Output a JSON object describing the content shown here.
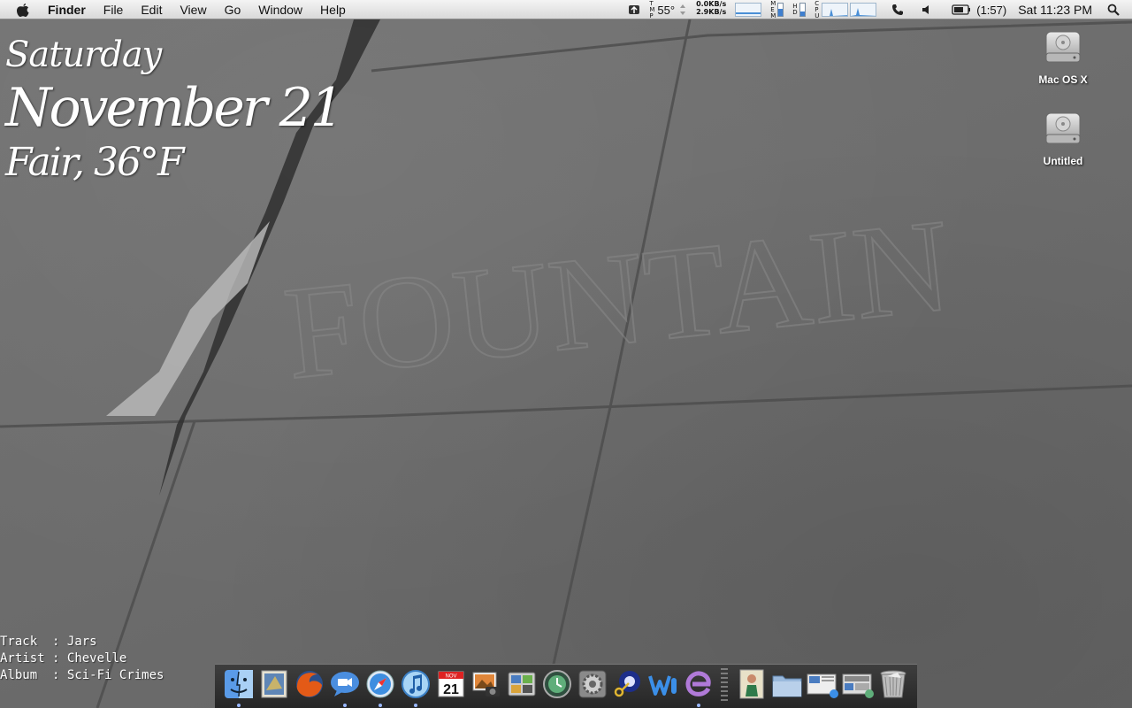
{
  "menubar": {
    "app_name": "Finder",
    "menus": [
      "File",
      "Edit",
      "View",
      "Go",
      "Window",
      "Help"
    ],
    "extras": {
      "temp_label": "TMP",
      "temperature": "55°",
      "net_down": "0.0KB/s",
      "net_up": "2.9KB/s",
      "mem_label": "MEM",
      "hd_label": "HD",
      "cpu_label": "CPU",
      "battery_time": "(1:57)",
      "clock": "Sat 11:23 PM"
    }
  },
  "date_widget": {
    "day": "Saturday",
    "date": "November 21",
    "weather": "Fair, 36°F"
  },
  "track_widget": {
    "track_label": "Track",
    "track": "Jars",
    "artist_label": "Artist",
    "artist": "Chevelle",
    "album_label": "Album",
    "album": "Sci-Fi Crimes",
    "separator": ":"
  },
  "desktop_icons": [
    {
      "label": "Mac OS X",
      "icon": "hard-drive-icon"
    },
    {
      "label": "Untitled",
      "icon": "hard-drive-icon"
    }
  ],
  "wallpaper_text": "FOUNTAIN",
  "dock": {
    "apps": [
      {
        "name": "finder-icon",
        "running": true
      },
      {
        "name": "mail-icon",
        "running": false
      },
      {
        "name": "firefox-icon",
        "running": false
      },
      {
        "name": "ichat-icon",
        "running": true
      },
      {
        "name": "safari-icon",
        "running": true
      },
      {
        "name": "itunes-icon",
        "running": true
      },
      {
        "name": "ical-icon",
        "running": false
      },
      {
        "name": "iphoto-icon",
        "running": false
      },
      {
        "name": "dashboard-icon",
        "running": false
      },
      {
        "name": "time-machine-icon",
        "running": false
      },
      {
        "name": "system-preferences-icon",
        "running": false
      },
      {
        "name": "keychain-icon",
        "running": false
      },
      {
        "name": "word-icon",
        "running": false
      },
      {
        "name": "editor-icon",
        "running": true
      }
    ],
    "ical_month": "NOV",
    "ical_day": "21",
    "stacks": [
      {
        "name": "picture-stack-icon"
      },
      {
        "name": "folder-stack-icon"
      },
      {
        "name": "documents-stack-icon"
      },
      {
        "name": "downloads-stack-icon"
      },
      {
        "name": "trash-icon"
      }
    ]
  }
}
